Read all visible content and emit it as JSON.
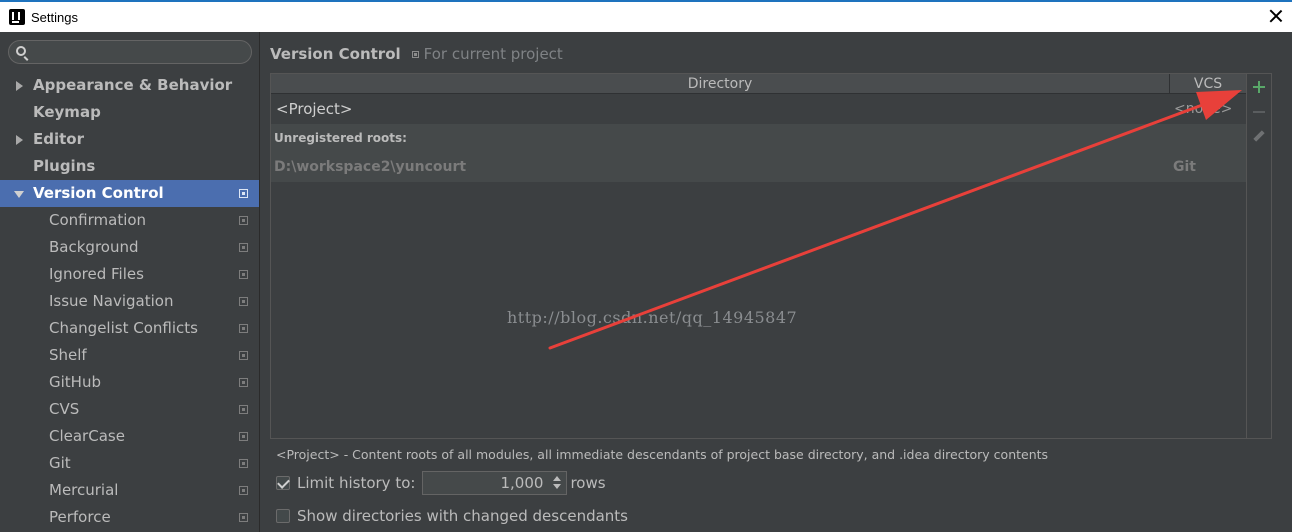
{
  "window": {
    "title": "Settings"
  },
  "search": {
    "placeholder": "",
    "value": ""
  },
  "sidebar": {
    "items": [
      {
        "label": "Appearance & Behavior",
        "level": 0,
        "expandable": true,
        "expanded": false
      },
      {
        "label": "Keymap",
        "level": 0
      },
      {
        "label": "Editor",
        "level": 0,
        "expandable": true,
        "expanded": false
      },
      {
        "label": "Plugins",
        "level": 0
      },
      {
        "label": "Version Control",
        "level": 0,
        "expandable": true,
        "expanded": true,
        "selected": true,
        "project_scoped": true
      },
      {
        "label": "Confirmation",
        "level": 1,
        "project_scoped": true
      },
      {
        "label": "Background",
        "level": 1,
        "project_scoped": true
      },
      {
        "label": "Ignored Files",
        "level": 1,
        "project_scoped": true
      },
      {
        "label": "Issue Navigation",
        "level": 1,
        "project_scoped": true
      },
      {
        "label": "Changelist Conflicts",
        "level": 1,
        "project_scoped": true
      },
      {
        "label": "Shelf",
        "level": 1,
        "project_scoped": true
      },
      {
        "label": "GitHub",
        "level": 1,
        "project_scoped": true
      },
      {
        "label": "CVS",
        "level": 1,
        "project_scoped": true
      },
      {
        "label": "ClearCase",
        "level": 1,
        "project_scoped": true
      },
      {
        "label": "Git",
        "level": 1,
        "project_scoped": true
      },
      {
        "label": "Mercurial",
        "level": 1,
        "project_scoped": true
      },
      {
        "label": "Perforce",
        "level": 1,
        "project_scoped": true
      }
    ]
  },
  "header": {
    "title": "Version Control",
    "scope": "For current project"
  },
  "table": {
    "columns": [
      "Directory",
      "VCS"
    ],
    "project_row": {
      "directory": "<Project>",
      "vcs": "<none>"
    },
    "unregistered_label": "Unregistered roots:",
    "unregistered_rows": [
      {
        "directory": "D:\\workspace2\\yuncourt",
        "vcs": "Git"
      }
    ]
  },
  "toolbar": {
    "add": "add-icon",
    "remove": "remove-icon",
    "edit": "edit-icon"
  },
  "watermark": "http://blog.csdn.net/qq_14945847",
  "footnote": "<Project> - Content roots of all modules, all immediate descendants of project base directory, and .idea directory contents",
  "options": {
    "limit_history": {
      "label": "Limit history to:",
      "checked": true,
      "value": "1,000",
      "suffix": "rows"
    },
    "show_changed": {
      "label": "Show directories with changed descendants",
      "checked": false
    }
  },
  "colors": {
    "background": "#3c3f41",
    "selection": "#4b6eaf",
    "add_green": "#59a869",
    "annotation_arrow": "#e8403a"
  }
}
